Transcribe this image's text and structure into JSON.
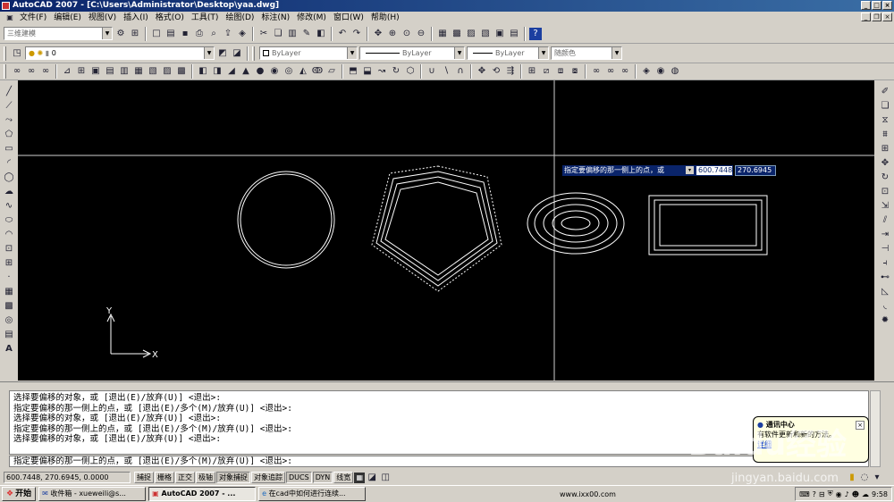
{
  "window": {
    "title": "AutoCAD 2007 - [C:\\Users\\Administrator\\Desktop\\yaa.dwg]"
  },
  "menu": [
    "文件(F)",
    "编辑(E)",
    "视图(V)",
    "插入(I)",
    "格式(O)",
    "工具(T)",
    "绘图(D)",
    "标注(N)",
    "修改(M)",
    "窗口(W)",
    "帮助(H)"
  ],
  "toolbar": {
    "workspace": "三维建模",
    "layer": "0",
    "color": "ByLayer",
    "linetype": "ByLayer",
    "lineweight": "ByLayer",
    "plotstyle": "随颜色"
  },
  "canvas": {
    "prompt": "指定要偏移的那一侧上的点，或",
    "coord_x": "600.7448",
    "coord_y": "270.6945",
    "axis_y": "Y",
    "axis_x": "X"
  },
  "command_history": [
    "选择要偏移的对象，或 [退出(E)/放弃(U)] <退出>:",
    "指定要偏移的那一侧上的点，或 [退出(E)/多个(M)/放弃(U)] <退出>:",
    "选择要偏移的对象，或 [退出(E)/放弃(U)] <退出>:",
    "指定要偏移的那一侧上的点，或 [退出(E)/多个(M)/放弃(U)] <退出>:",
    "选择要偏移的对象，或 [退出(E)/放弃(U)] <退出>:"
  ],
  "command_line": "指定要偏移的那一侧上的点，或 [退出(E)/多个(M)/放弃(U)] <退出>:",
  "status": {
    "coords": "600.7448, 270.6945, 0.0000",
    "buttons": [
      "捕捉",
      "栅格",
      "正交",
      "极轴",
      "对象捕捉",
      "对象追踪",
      "DUCS",
      "DYN",
      "线宽"
    ],
    "active": [
      "对象捕捉",
      "DUCS",
      "DYN"
    ]
  },
  "balloon": {
    "title": "通讯中心",
    "text": "有软件更新和新的",
    "text2": "方法。",
    "link": "详细"
  },
  "taskbar": {
    "start": "开始",
    "tasks": [
      "收件箱 - xueweili@s...",
      "AutoCAD 2007 - ...",
      "在cad中如何进行连续..."
    ],
    "url": "www.ixx00.com",
    "time": "9:58"
  },
  "watermark": {
    "brand": "Baidu经验",
    "site": "jingyan.baidu.com"
  },
  "colors": {
    "canvas": "#000000",
    "titlebar": "#0a246a"
  }
}
